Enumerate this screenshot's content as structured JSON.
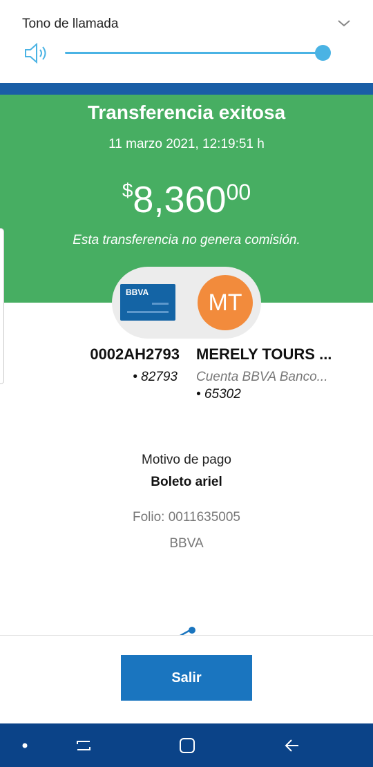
{
  "volume": {
    "title": "Tono de llamada",
    "level_percent": 100
  },
  "header": {
    "title": "Transferencia exitosa",
    "datetime": "11 marzo 2021, 12:19:51 h",
    "amount": {
      "currency_symbol": "$",
      "integer": "8,360",
      "decimals": "00"
    },
    "commission_note": "Esta transferencia no genera comisión."
  },
  "origin": {
    "card_brand": "BBVA",
    "name": "0002AH2793",
    "account": "• 82793"
  },
  "destination": {
    "initials": "MT",
    "name": "MERELY TOURS ...",
    "bank": "Cuenta BBVA Banco...",
    "account": "• 65302"
  },
  "details": {
    "reason_label": "Motivo de pago",
    "reason_value": "Boleto ariel",
    "folio": "Folio: 0011635005",
    "bank": "BBVA"
  },
  "actions": {
    "exit_label": "Salir"
  },
  "colors": {
    "success_green": "#47ae62",
    "brand_blue": "#1a5ea6",
    "button_blue": "#1a75bf",
    "nav_blue": "#0b4388",
    "slider_blue": "#4ab3e4",
    "avatar_orange": "#f28b3c"
  },
  "icons": {
    "volume": "speaker-icon",
    "expand": "chevron-down-icon",
    "share": "share-icon",
    "nav": [
      "dot-icon",
      "recents-icon",
      "home-icon",
      "back-icon"
    ]
  }
}
